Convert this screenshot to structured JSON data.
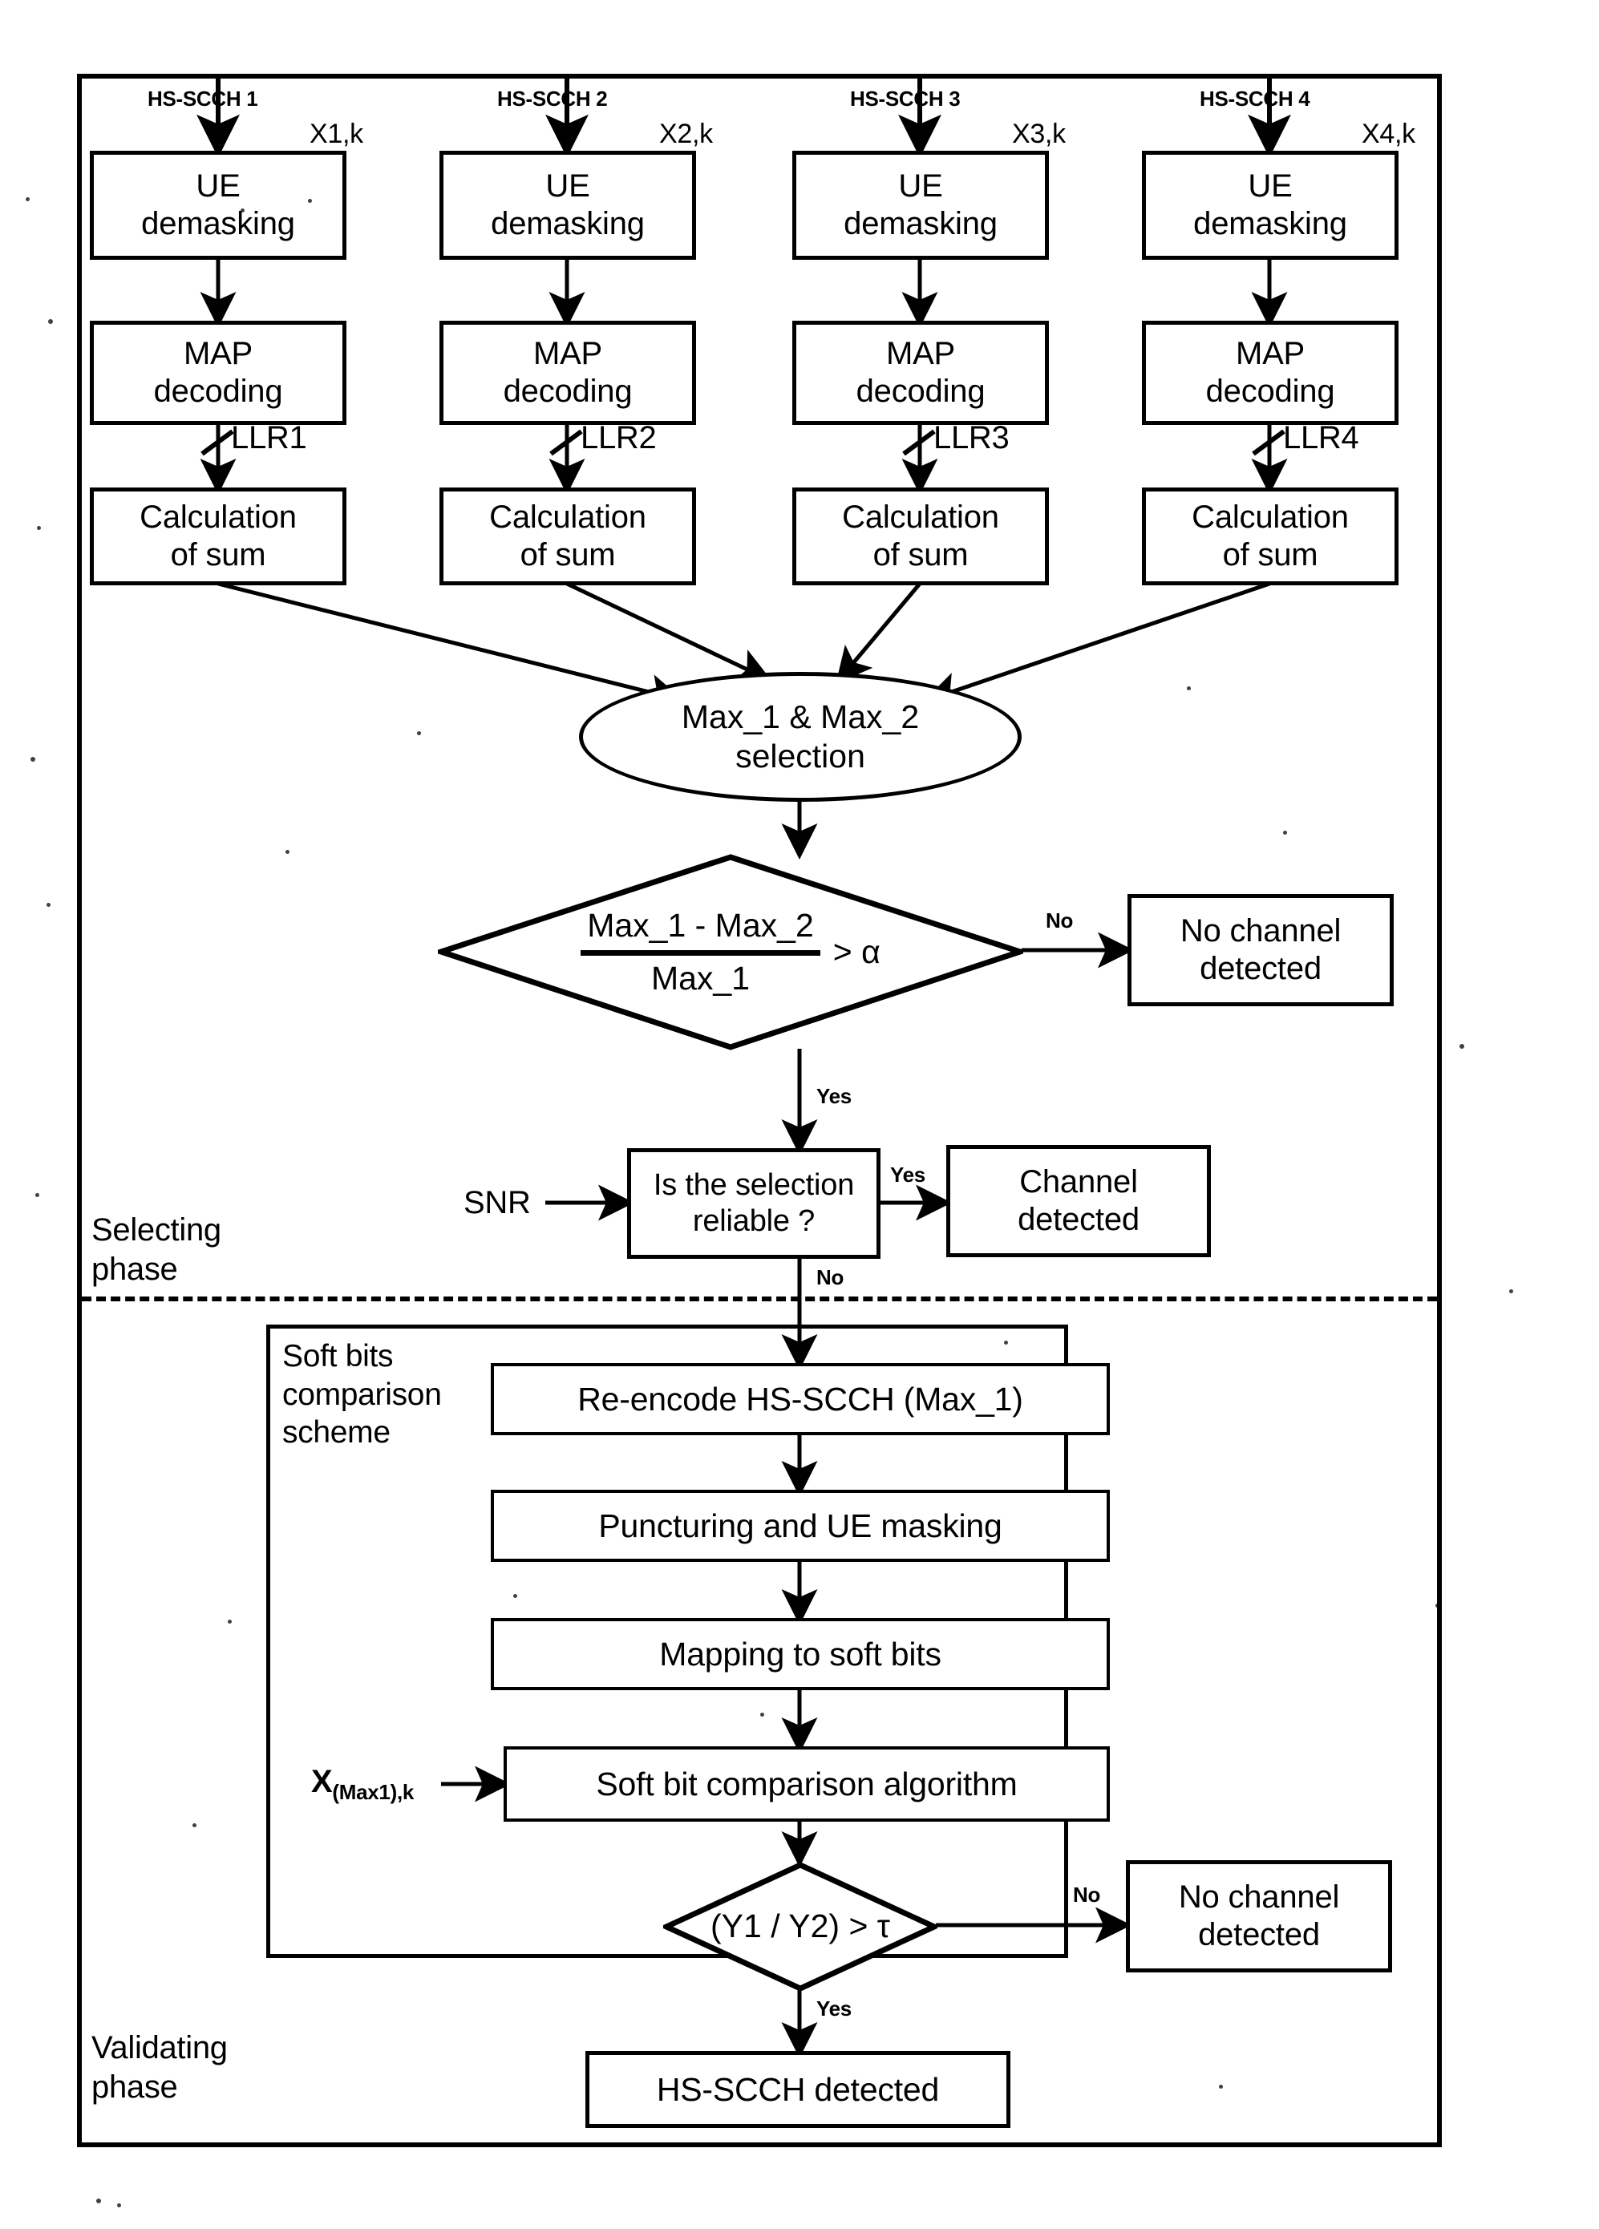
{
  "figure": {
    "type": "flowchart",
    "title": "HS-SCCH detection flowchart (selecting phase / validating phase)"
  },
  "channels": [
    {
      "source_label": "HS-SCCH 1",
      "signal_label": "X1,k",
      "demask": "UE\ndemasking",
      "decode": "MAP\ndecoding",
      "llr": "LLR1",
      "sum": "Calculation\nof sum"
    },
    {
      "source_label": "HS-SCCH 2",
      "signal_label": "X2,k",
      "demask": "UE\ndemasking",
      "decode": "MAP\ndecoding",
      "llr": "LLR2",
      "sum": "Calculation\nof sum"
    },
    {
      "source_label": "HS-SCCH 3",
      "signal_label": "X3,k",
      "demask": "UE\ndemasking",
      "decode": "MAP\ndecoding",
      "llr": "LLR3",
      "sum": "Calculation\nof sum"
    },
    {
      "source_label": "HS-SCCH 4",
      "signal_label": "X4,k",
      "demask": "UE\ndemasking",
      "decode": "MAP\ndecoding",
      "llr": "LLR4",
      "sum": "Calculation\nof sum"
    }
  ],
  "nodes": {
    "demask_line1": "UE",
    "demask_line2": "demasking",
    "decode_line1": "MAP",
    "decode_line2": "decoding",
    "sum_line1": "Calculation",
    "sum_line2": "of sum",
    "selection_line1": "Max_1 & Max_2",
    "selection_line2": "selection",
    "threshold_numerator": "Max_1 - Max_2",
    "threshold_denominator": "Max_1",
    "threshold_comparison": "> α",
    "no_channel_detected_line1": "No channel",
    "no_channel_detected_line2": "detected",
    "reliable_line1": "Is the selection",
    "reliable_line2": "reliable ?",
    "channel_detected_line1": "Channel",
    "channel_detected_line2": "detected",
    "reencode": "Re-encode HS-SCCH (Max_1)",
    "puncturing": "Puncturing and UE masking",
    "mapping": "Mapping to soft bits",
    "soft_bit_algorithm": "Soft bit comparison algorithm",
    "ratio_test": "(Y1 / Y2) > τ",
    "no_channel_detected2_line1": "No channel",
    "no_channel_detected2_line2": "detected",
    "hs_scch_detected": "HS-SCCH detected"
  },
  "inputs": {
    "snr": "SNR",
    "x_max1_k_base": "X",
    "x_max1_k_sub": "(Max1),k"
  },
  "edge_labels": {
    "no": "No",
    "yes": "Yes",
    "no_lower": "No",
    "yes_reliable": "Yes",
    "no_reliable": "No",
    "no_ratio": "No",
    "yes_ratio": "Yes"
  },
  "regions": {
    "selecting_phase": "Selecting\nphase",
    "validating_phase": "Validating\nphase",
    "soft_bits_scheme": "Soft bits\ncomparison\nscheme"
  },
  "colors": {
    "line": "#000000",
    "background": "#ffffff",
    "text": "#000000"
  }
}
